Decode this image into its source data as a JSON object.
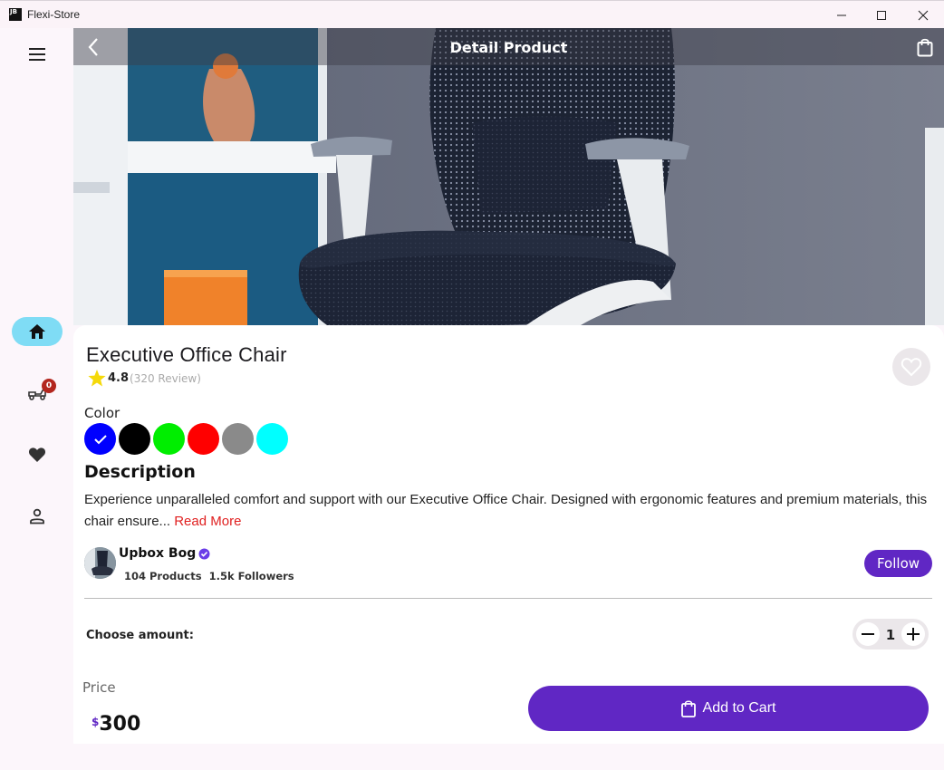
{
  "window": {
    "app_icon_text": "JB",
    "title": "Flexi-Store"
  },
  "nav": {
    "cart_badge": "0",
    "items": [
      {
        "icon": "home-icon",
        "active": true
      },
      {
        "icon": "delivery-icon",
        "active": false
      },
      {
        "icon": "heart-icon",
        "active": false
      },
      {
        "icon": "person-icon",
        "active": false
      }
    ]
  },
  "header": {
    "title": "Detail Product"
  },
  "product": {
    "name": "Executive Office Chair",
    "rating": "4.8",
    "reviews": "(320 Review)",
    "color_label": "Color",
    "colors": [
      "#0000ff",
      "#000000",
      "#00ee00",
      "#ff0000",
      "#8a8a8a",
      "#00ffff"
    ],
    "selected_color_index": 0,
    "description_title": "Description",
    "description": "Experience unparalleled comfort and support with our Executive Office Chair. Designed with ergonomic features and premium materials, this chair ensure...",
    "read_more": "Read More"
  },
  "seller": {
    "name": "Upbox Bog",
    "verified": true,
    "products": "104 Products",
    "followers": "1.5k Followers",
    "follow_label": "Follow"
  },
  "amount": {
    "label": "Choose amount:",
    "value": "1"
  },
  "price": {
    "label": "Price",
    "currency": "$",
    "value": "300"
  },
  "cart": {
    "label": "Add to Cart"
  },
  "colors": {
    "accent": "#6027c4",
    "rail_active": "#7fdcf5",
    "badge": "#b3261e",
    "read_more": "#e02020",
    "star": "#f5d90a"
  }
}
